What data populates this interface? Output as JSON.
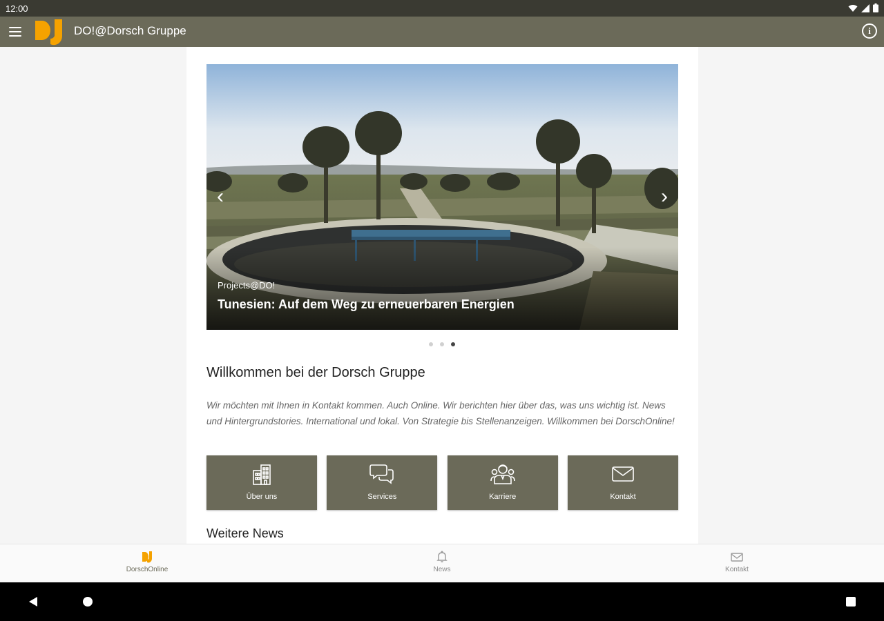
{
  "status_bar": {
    "time": "12:00"
  },
  "app_bar": {
    "title": "DO!@Dorsch Gruppe"
  },
  "slider": {
    "category": "Projects@DO!",
    "title": "Tunesien: Auf dem Weg zu erneuerbaren Energien",
    "slide_count": 3,
    "active_slide": 3
  },
  "welcome": {
    "title": "Willkommen bei der Dorsch Gruppe",
    "text": "Wir möchten mit Ihnen in Kontakt kommen. Auch Online. Wir berichten hier über das, was uns wichtig ist. News und Hintergrundstories. International und lokal. Von Strategie bis Stellenanzeigen. Willkommen bei DorschOnline!"
  },
  "tiles": [
    {
      "label": "Über uns",
      "icon": "building-icon"
    },
    {
      "label": "Services",
      "icon": "chat-bubbles-icon"
    },
    {
      "label": "Karriere",
      "icon": "people-icon"
    },
    {
      "label": "Kontakt",
      "icon": "envelope-icon"
    }
  ],
  "news_heading": "Weitere News",
  "bottom_nav": [
    {
      "label": "DorschOnline",
      "icon": "dorsch-logo-icon",
      "active": true
    },
    {
      "label": "News",
      "icon": "bell-icon",
      "active": false
    },
    {
      "label": "Kontakt",
      "icon": "mail-icon",
      "active": false
    }
  ],
  "colors": {
    "app_bar": "#6b6a59",
    "status_bar": "#3a3a32",
    "brand_orange": "#f5a200",
    "tile": "#6b6a59"
  }
}
